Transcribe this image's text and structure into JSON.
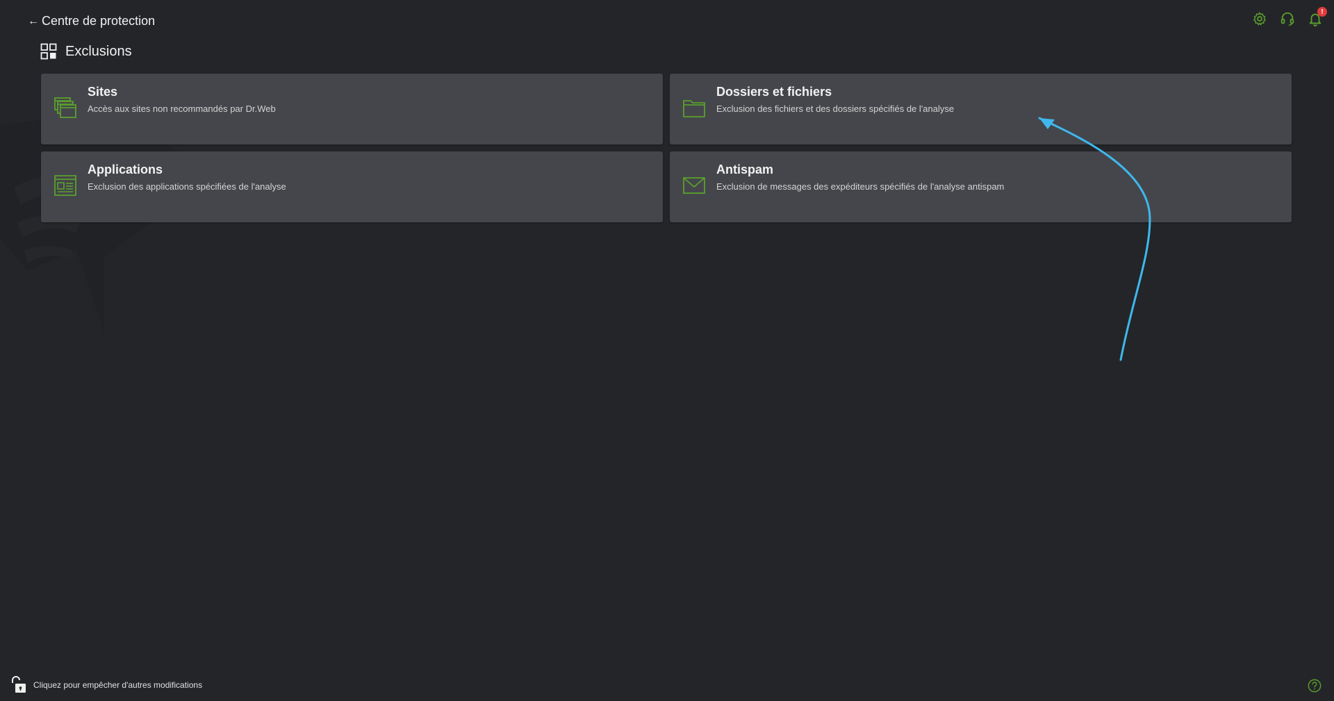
{
  "header": {
    "back_label": "Centre de protection",
    "icons": [
      "gear-icon",
      "headset-icon",
      "bell-icon"
    ],
    "notification_count": "!"
  },
  "page": {
    "title": "Exclusions",
    "title_icon": "grid-icon"
  },
  "cards": [
    {
      "title": "Sites",
      "description": "Accès aux sites non recommandés par Dr.Web",
      "icon": "browser-windows-icon"
    },
    {
      "title": "Dossiers et fichiers",
      "description": "Exclusion des fichiers et des dossiers spécifiés de l'analyse",
      "icon": "folder-icon"
    },
    {
      "title": "Applications",
      "description": "Exclusion des applications spécifiées de l'analyse",
      "icon": "application-window-icon"
    },
    {
      "title": "Antispam",
      "description": "Exclusion de messages des expéditeurs spécifiés de l'analyse antispam",
      "icon": "envelope-icon"
    }
  ],
  "footer": {
    "lock_label": "Cliquez pour empêcher d'autres modifications",
    "lock_icon": "unlock-icon",
    "help_icon": "help-icon"
  },
  "colors": {
    "background": "#242529",
    "card": "#45464b",
    "accent_green": "#5aa02c",
    "badge_red": "#e23b3b",
    "annotation_blue": "#3fb8ee"
  }
}
